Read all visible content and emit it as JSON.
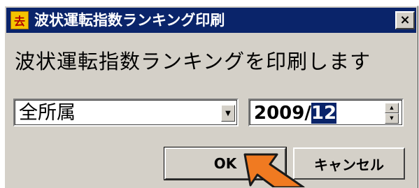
{
  "window": {
    "title": "波状運転指数ランキング印刷",
    "icon": "app-icon",
    "icon_glyph": "去",
    "close_label": "×"
  },
  "message": "波状運転指数ランキングを印刷します",
  "filter": {
    "selected": "全所属"
  },
  "period": {
    "year_prefix": "2009/",
    "month_selected": "12"
  },
  "buttons": {
    "ok": "OK",
    "cancel": "キャンセル"
  },
  "colors": {
    "titlebar": "#0a246a",
    "dialog_face": "#d4d0c8",
    "highlight_arrow": "#f07a21"
  }
}
